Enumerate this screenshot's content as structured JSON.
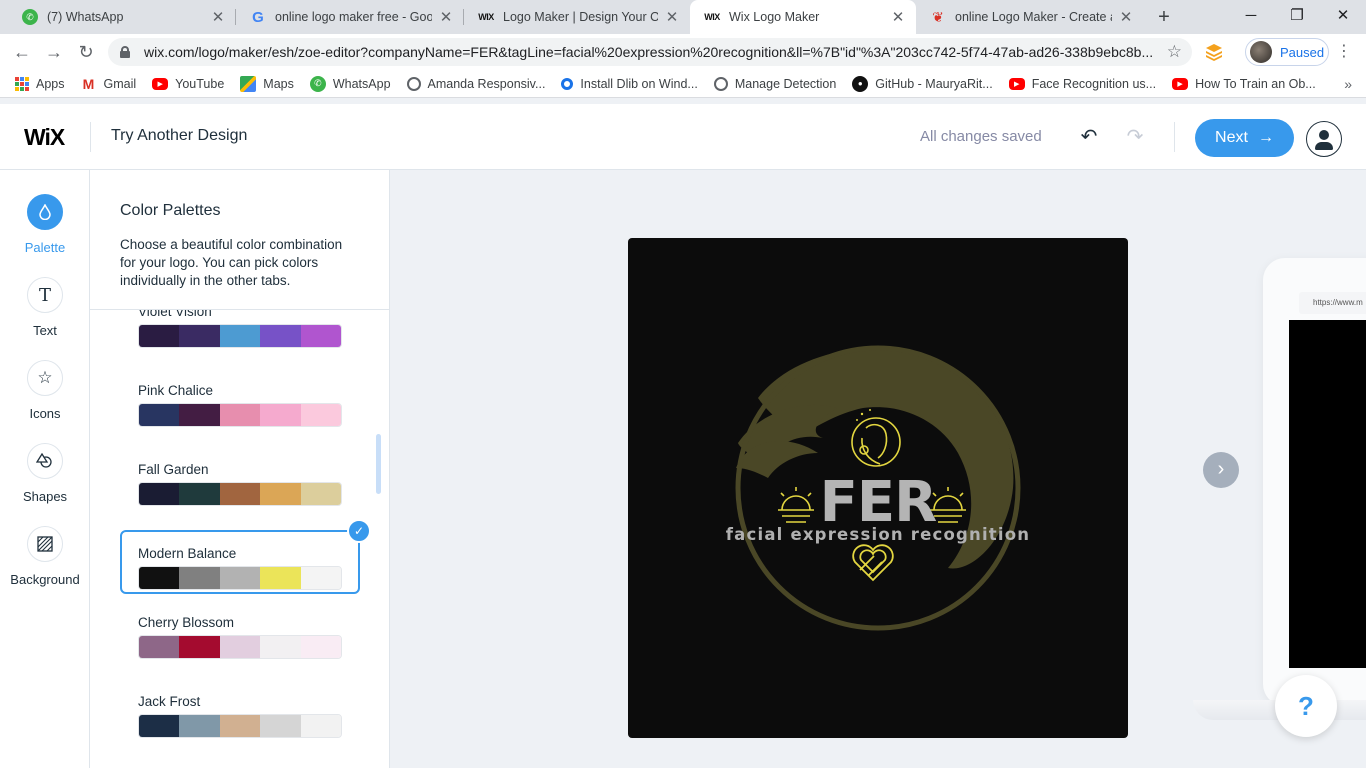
{
  "browser": {
    "tabs": [
      {
        "title": "(7) WhatsApp",
        "favicon": "whatsapp-icon"
      },
      {
        "title": "online logo maker free - Goog",
        "favicon": "google-icon"
      },
      {
        "title": "Logo Maker | Design Your Own",
        "favicon": "wix-icon"
      },
      {
        "title": "Wix Logo Maker",
        "favicon": "wix-icon",
        "active": true
      },
      {
        "title": "online Logo Maker - Create a c",
        "favicon": "red-brand-icon"
      }
    ],
    "url": "wix.com/logo/maker/esh/zoe-editor?companyName=FER&tagLine=facial%20expression%20recognition&ll=%7B\"id\"%3A\"203cc742-5f74-47ab-ad26-338b9ebc8b...",
    "profile_status": "Paused",
    "bookmarks": [
      {
        "label": "Apps",
        "icon": "apps-grid-icon"
      },
      {
        "label": "Gmail",
        "icon": "gmail-icon"
      },
      {
        "label": "YouTube",
        "icon": "youtube-icon"
      },
      {
        "label": "Maps",
        "icon": "maps-icon"
      },
      {
        "label": "WhatsApp",
        "icon": "whatsapp-icon"
      },
      {
        "label": "Amanda Responsiv...",
        "icon": "globe-icon"
      },
      {
        "label": "Install Dlib on Wind...",
        "icon": "dlib-icon"
      },
      {
        "label": "Manage Detection",
        "icon": "globe-icon"
      },
      {
        "label": "GitHub - MauryaRit...",
        "icon": "github-icon"
      },
      {
        "label": "Face Recognition us...",
        "icon": "youtube-icon"
      },
      {
        "label": "How To Train an Ob...",
        "icon": "youtube-icon"
      }
    ]
  },
  "header": {
    "logo": "WiX",
    "title": "Try Another Design",
    "save_status": "All changes saved",
    "next_label": "Next"
  },
  "leftnav": [
    {
      "label": "Palette",
      "icon": "palette-drop-icon",
      "active": true
    },
    {
      "label": "Text",
      "icon": "text-icon"
    },
    {
      "label": "Icons",
      "icon": "star-icon"
    },
    {
      "label": "Shapes",
      "icon": "shapes-icon"
    },
    {
      "label": "Background",
      "icon": "background-icon"
    }
  ],
  "panel": {
    "title": "Color Palettes",
    "description": "Choose a beautiful color combination for your logo. You can pick colors individually in the other tabs.",
    "palettes": [
      {
        "name": "Violet Vision",
        "colors": [
          "#2a1c42",
          "#3a2b63",
          "#4d9bd2",
          "#7752c7",
          "#b055cf"
        ]
      },
      {
        "name": "Pink Chalice",
        "colors": [
          "#283561",
          "#431d43",
          "#e78eae",
          "#f5aace",
          "#fbc9dd"
        ]
      },
      {
        "name": "Fall Garden",
        "colors": [
          "#1a1c33",
          "#1f3a3c",
          "#a1653f",
          "#dba656",
          "#dcce9c"
        ]
      },
      {
        "name": "Modern Balance",
        "colors": [
          "#111111",
          "#808080",
          "#b2b2b2",
          "#ebe459",
          "#f4f4f4"
        ],
        "selected": true
      },
      {
        "name": "Cherry Blossom",
        "colors": [
          "#8e6788",
          "#a40b2f",
          "#e2cedf",
          "#f2f0f2",
          "#f9ecf4"
        ]
      },
      {
        "name": "Jack Frost",
        "colors": [
          "#1c2e46",
          "#8098a8",
          "#d1b091",
          "#d5d5d5",
          "#f2f2f2"
        ]
      }
    ]
  },
  "logo": {
    "name": "FER",
    "tagline": "facial expression recognition",
    "colors": {
      "background": "#0c0c0c",
      "text": "#b4b4b4",
      "accent": "#e3d640",
      "shape": "#4a4726"
    }
  },
  "preview": {
    "url": "https://www.m"
  },
  "help_label": "?"
}
